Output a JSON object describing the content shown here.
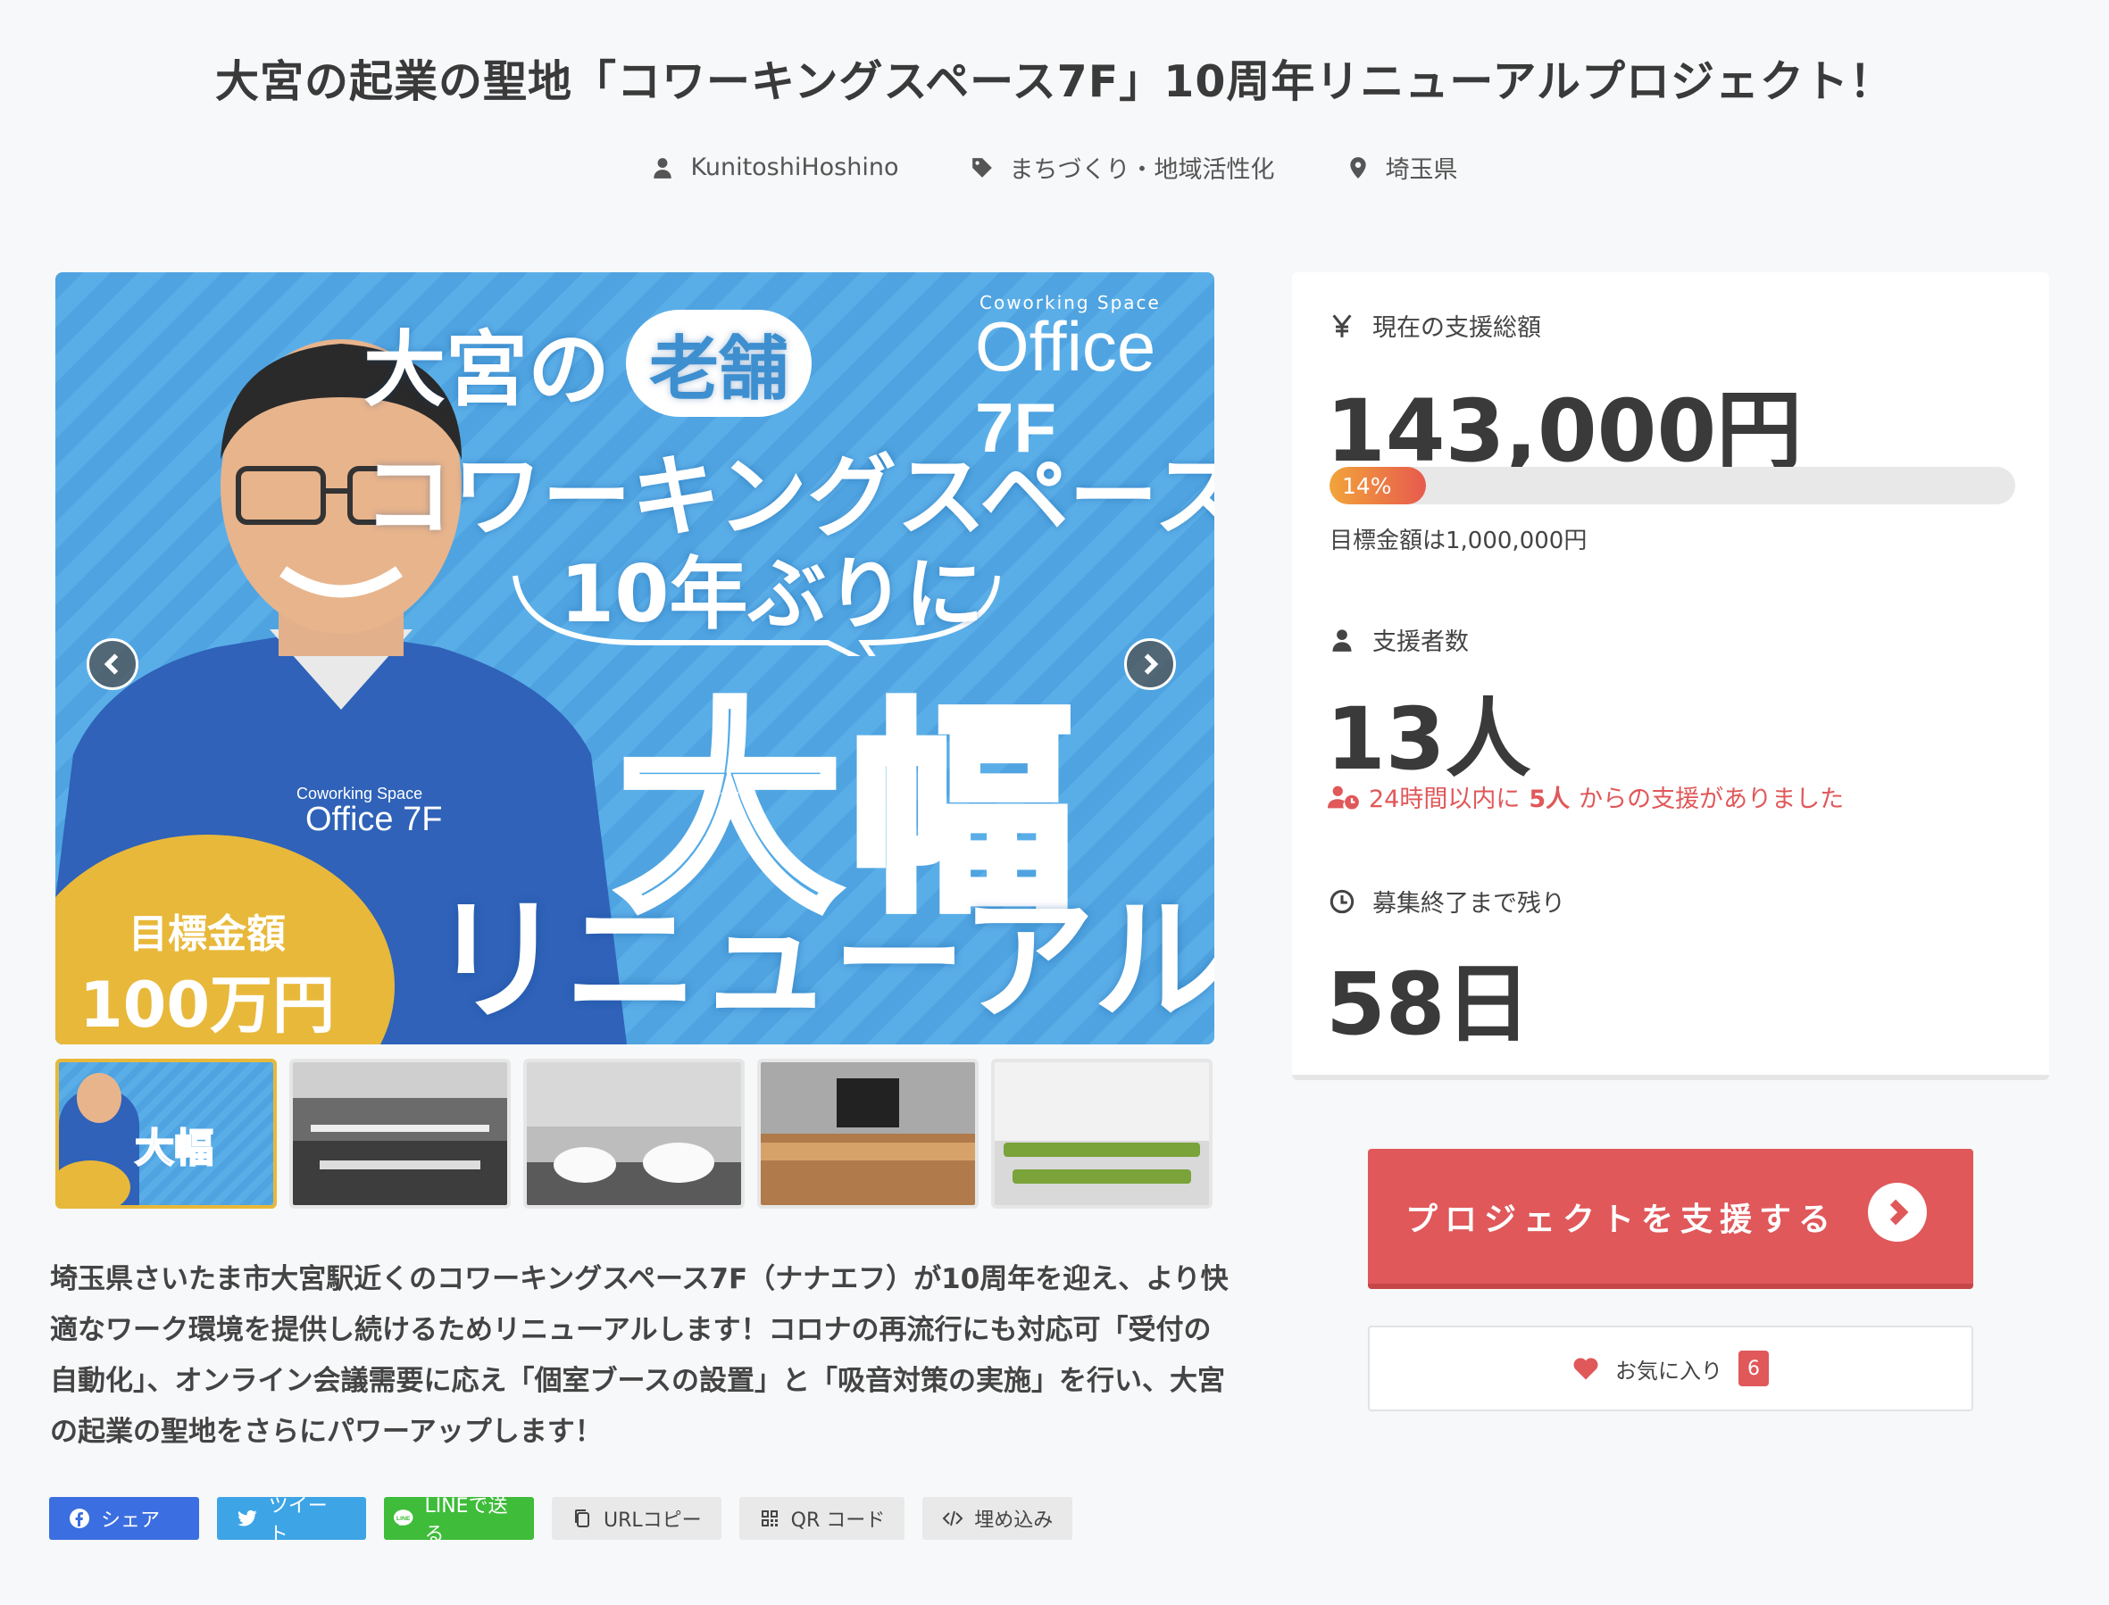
{
  "project": {
    "title": "大宮の起業の聖地「コワーキングスペース7F」10周年リニューアルプロジェクト！",
    "owner": "KunitoshiHoshino",
    "category": "まちづくり・地域活性化",
    "location": "埼玉県"
  },
  "hero": {
    "brand_sub": "Coworking Space",
    "brand": "Office",
    "brand_num": "7F",
    "line1a": "大宮の",
    "line1b": "老舗",
    "line2": "コワーキングスペースが",
    "line3": "10年ぶりに",
    "line4": "大幅",
    "line5": "リニューアル!?",
    "goal_label": "目標金額",
    "goal_value": "100万円",
    "shirt_logo": "Office 7F"
  },
  "thumbnails": [
    {
      "kind": "banner",
      "active": true
    },
    {
      "kind": "workspace-people",
      "active": false
    },
    {
      "kind": "lounge",
      "active": false
    },
    {
      "kind": "desk",
      "active": false
    },
    {
      "kind": "seminar-room",
      "active": false
    }
  ],
  "description": "埼玉県さいたま市大宮駅近くのコワーキングスペース7F（ナナエフ）が10周年を迎え、より快適なワーク環境を提供し続けるためリニューアルします！コロナの再流行にも対応可「受付の自動化」、オンライン会議需要に応え「個室ブースの設置」と「吸音対策の実施」を行い、大宮の起業の聖地をさらにパワーアップします！",
  "share": {
    "facebook": "シェア",
    "twitter": "ツイート",
    "line": "LINEで送る",
    "url_copy": "URLコピー",
    "qr": "QR コード",
    "embed": "埋め込み"
  },
  "stats": {
    "total_label": "現在の支援総額",
    "total_value": "143,000円",
    "progress_percent": 14,
    "progress_label": "14%",
    "goal_text": "目標金額は1,000,000円",
    "backers_label": "支援者数",
    "backers_value": "13人",
    "recent_prefix": "24時間以内に",
    "recent_count": "5人",
    "recent_suffix": "からの支援がありました",
    "remaining_label": "募集終了まで残り",
    "remaining_value": "58日"
  },
  "actions": {
    "support_label": "プロジェクトを支援する",
    "favorite_label": "お気に入り",
    "favorite_count": "6"
  },
  "colors": {
    "accent": "#e0585a",
    "hero_blue": "#4ea3e0",
    "goal_yellow": "#e8b83b"
  }
}
